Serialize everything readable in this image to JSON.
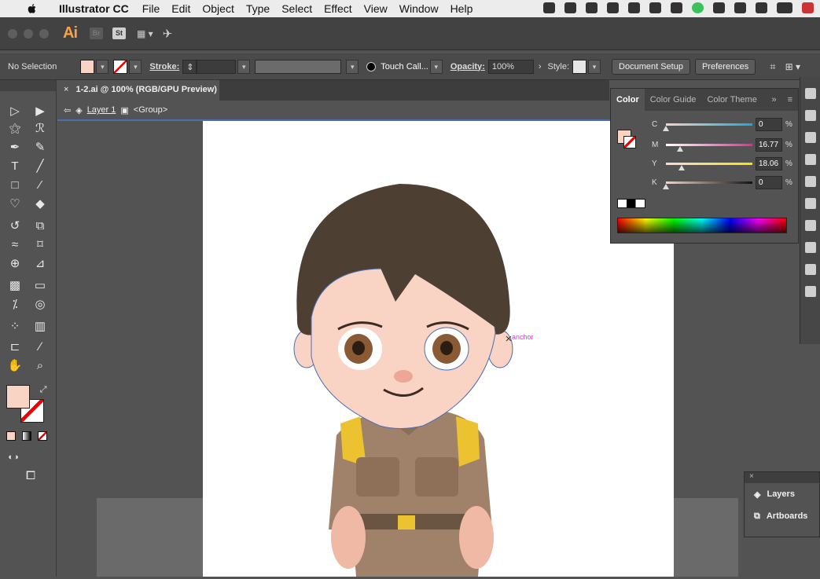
{
  "menubar": {
    "app": "Illustrator CC",
    "items": [
      "File",
      "Edit",
      "Object",
      "Type",
      "Select",
      "Effect",
      "View",
      "Window",
      "Help"
    ]
  },
  "approw": {
    "logo": "Ai",
    "br": "Br",
    "st": "St"
  },
  "control": {
    "selection": "No Selection",
    "stroke_label": "Stroke:",
    "brush": "Touch Call...",
    "opacity_label": "Opacity:",
    "opacity": "100%",
    "style_label": "Style:",
    "document_setup": "Document Setup",
    "preferences": "Preferences"
  },
  "document": {
    "tab": "1-2.ai @ 100% (RGB/GPU Preview)",
    "layer": "Layer 1",
    "group": "<Group>",
    "anchor_label": "anchor"
  },
  "color_panel": {
    "tabs": [
      "Color",
      "Color Guide",
      "Color Theme"
    ],
    "sliders": [
      {
        "label": "C",
        "value": "0",
        "fraction": 0.0
      },
      {
        "label": "M",
        "value": "16.77",
        "fraction": 0.1677
      },
      {
        "label": "Y",
        "value": "18.06",
        "fraction": 0.1806
      },
      {
        "label": "K",
        "value": "0",
        "fraction": 0.0
      }
    ],
    "percent": "%"
  },
  "layers_panel": {
    "layers": "Layers",
    "artboards": "Artboards"
  },
  "colors": {
    "fill": "#f9d3c3",
    "accent": "#4a6fb5"
  }
}
